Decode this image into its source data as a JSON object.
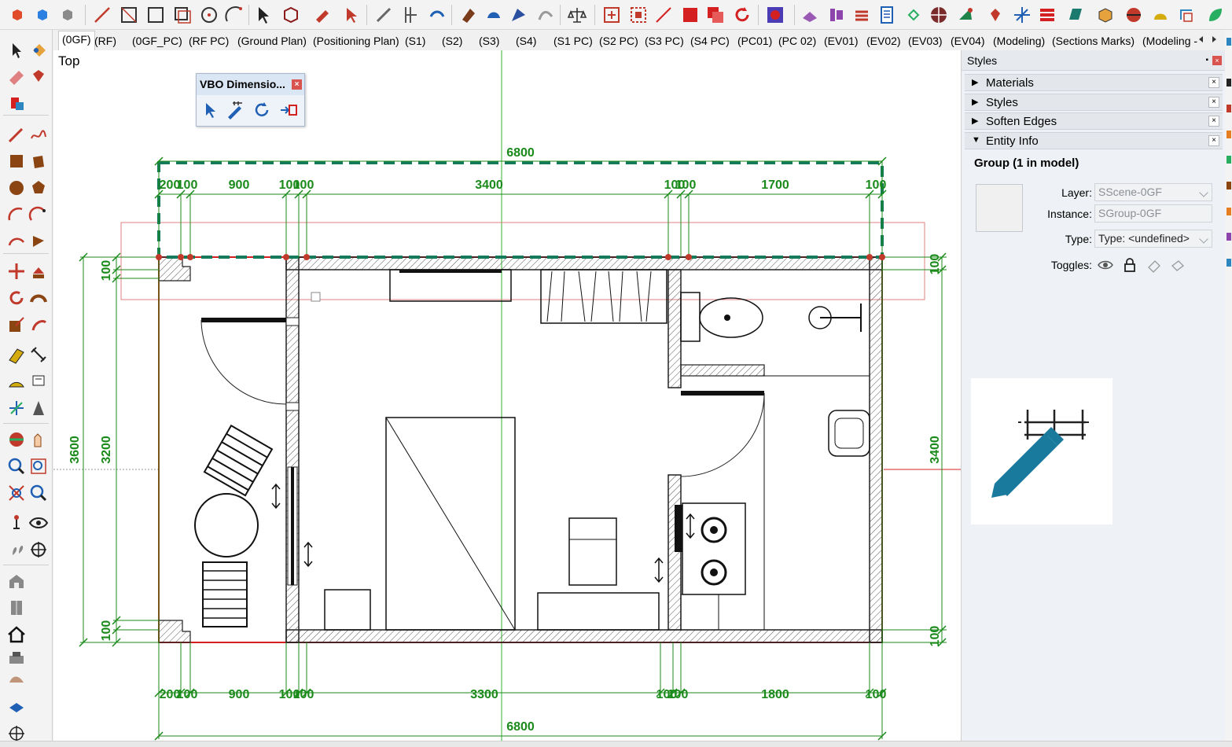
{
  "viewport": {
    "scene_label": "Top"
  },
  "tabs": [
    {
      "label": "(0GF)",
      "active": true
    },
    {
      "label": "(RF)"
    },
    {
      "label": "(0GF_PC)"
    },
    {
      "label": "(RF PC)"
    },
    {
      "label": "(Ground Plan)"
    },
    {
      "label": "(Positioning Plan)"
    },
    {
      "label": "(S1)"
    },
    {
      "label": "(S2)"
    },
    {
      "label": "(S3)"
    },
    {
      "label": "(S4)"
    },
    {
      "label": "(S1 PC)"
    },
    {
      "label": "(S2 PC)"
    },
    {
      "label": "(S3 PC)"
    },
    {
      "label": "(S4 PC)"
    },
    {
      "label": "(PC01)"
    },
    {
      "label": "(PC 02)"
    },
    {
      "label": "(EV01)"
    },
    {
      "label": "(EV02)"
    },
    {
      "label": "(EV03)"
    },
    {
      "label": "(EV04)"
    },
    {
      "label": "(Modeling)"
    },
    {
      "label": "(Sections Marks)"
    },
    {
      "label": "(Modeling -"
    }
  ],
  "vbo_toolbar": {
    "title": "VBO Dimensio...",
    "close": "×"
  },
  "tray": {
    "title": "Styles",
    "pin": "▪",
    "close": "×",
    "sections": [
      {
        "label": "Materials",
        "expanded": false
      },
      {
        "label": "Styles",
        "expanded": false
      },
      {
        "label": "Soften Edges",
        "expanded": false
      },
      {
        "label": "Entity Info",
        "expanded": true
      }
    ],
    "section_close": "×",
    "arrow_collapsed": "▶",
    "arrow_expanded": "▼"
  },
  "entity_info": {
    "title": "Group (1 in model)",
    "layer_label": "Layer:",
    "layer_value": "SScene-0GF",
    "instance_label": "Instance:",
    "instance_value": "SGroup-0GF",
    "type_label": "Type:",
    "type_value": "Type: <undefined>",
    "toggles_label": "Toggles:"
  },
  "dimensions": {
    "top_overall": "6800",
    "top_segments": [
      "200",
      "100",
      "900",
      "100",
      "100",
      "3400",
      "100",
      "100",
      "1700",
      "100"
    ],
    "bottom_overall": "6800",
    "bottom_segments": [
      "200",
      "100",
      "900",
      "100",
      "100",
      "3300",
      "100",
      "100",
      "1800",
      "100"
    ],
    "left_overall": "3600",
    "left_inner": "3200",
    "left_top": "100",
    "left_bottom": "100",
    "right_overall": "3400",
    "right_top": "100",
    "right_bottom": "100"
  },
  "colors": {
    "dimension_green": "#1a8a1a",
    "dashed_green": "#137a5c",
    "selection_red": "#d42020",
    "accent_blue": "#1f5fb4"
  }
}
